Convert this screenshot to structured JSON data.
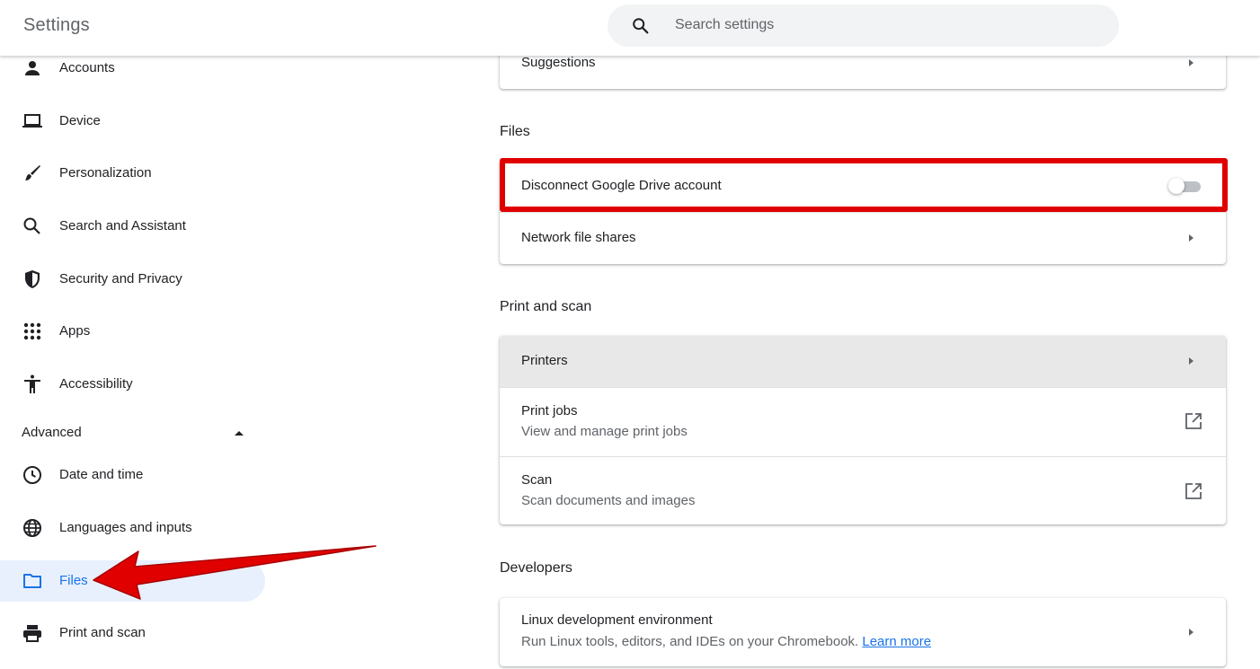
{
  "header": {
    "title": "Settings",
    "search_placeholder": "Search settings"
  },
  "sidebar": {
    "items": [
      {
        "label": "Accounts",
        "icon": "person-icon"
      },
      {
        "label": "Device",
        "icon": "laptop-icon"
      },
      {
        "label": "Personalization",
        "icon": "brush-icon"
      },
      {
        "label": "Search and Assistant",
        "icon": "search-icon"
      },
      {
        "label": "Security and Privacy",
        "icon": "shield-icon"
      },
      {
        "label": "Apps",
        "icon": "apps-grid-icon"
      },
      {
        "label": "Accessibility",
        "icon": "accessibility-icon"
      }
    ],
    "advanced_label": "Advanced",
    "advanced_items": [
      {
        "label": "Date and time",
        "icon": "clock-icon"
      },
      {
        "label": "Languages and inputs",
        "icon": "globe-icon"
      },
      {
        "label": "Files",
        "icon": "folder-icon",
        "selected": true
      },
      {
        "label": "Print and scan",
        "icon": "printer-icon"
      }
    ]
  },
  "main": {
    "suggestions_label": "Suggestions",
    "files": {
      "title": "Files",
      "disconnect_label": "Disconnect Google Drive account",
      "disconnect_enabled": false,
      "network_label": "Network file shares"
    },
    "print": {
      "title": "Print and scan",
      "printers_label": "Printers",
      "print_jobs_label": "Print jobs",
      "print_jobs_sub": "View and manage print jobs",
      "scan_label": "Scan",
      "scan_sub": "Scan documents and images"
    },
    "developers": {
      "title": "Developers",
      "linux_label": "Linux development environment",
      "linux_sub": "Run Linux tools, editors, and IDEs on your Chromebook.",
      "learn_more": "Learn more"
    }
  },
  "colors": {
    "accent": "#1a73e8",
    "selected_bg": "#e8f0fe",
    "annotation_red": "#e00000"
  }
}
